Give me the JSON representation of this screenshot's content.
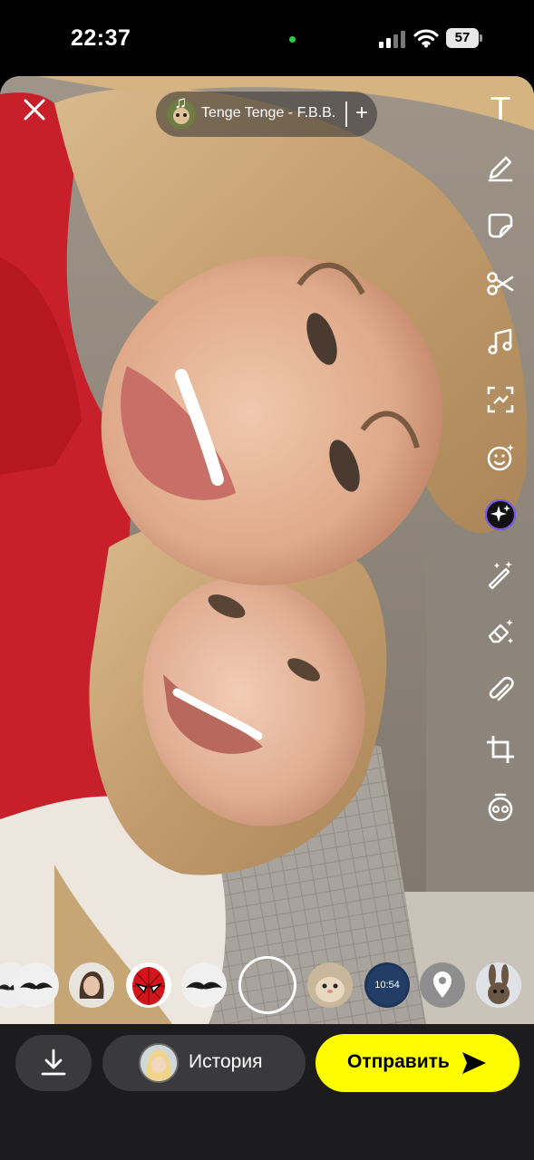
{
  "status_bar": {
    "time": "22:37",
    "battery": "57"
  },
  "top_bar": {
    "music_title": "Tenge Tenge - F.B.B.",
    "music_note": "♫",
    "add_symbol": "+"
  },
  "toolbar": {
    "text_tool": "T"
  },
  "lenses": {
    "clock_lens_label": "10:54"
  },
  "bottom_bar": {
    "story_label": "История",
    "send_label": "Отправить"
  }
}
